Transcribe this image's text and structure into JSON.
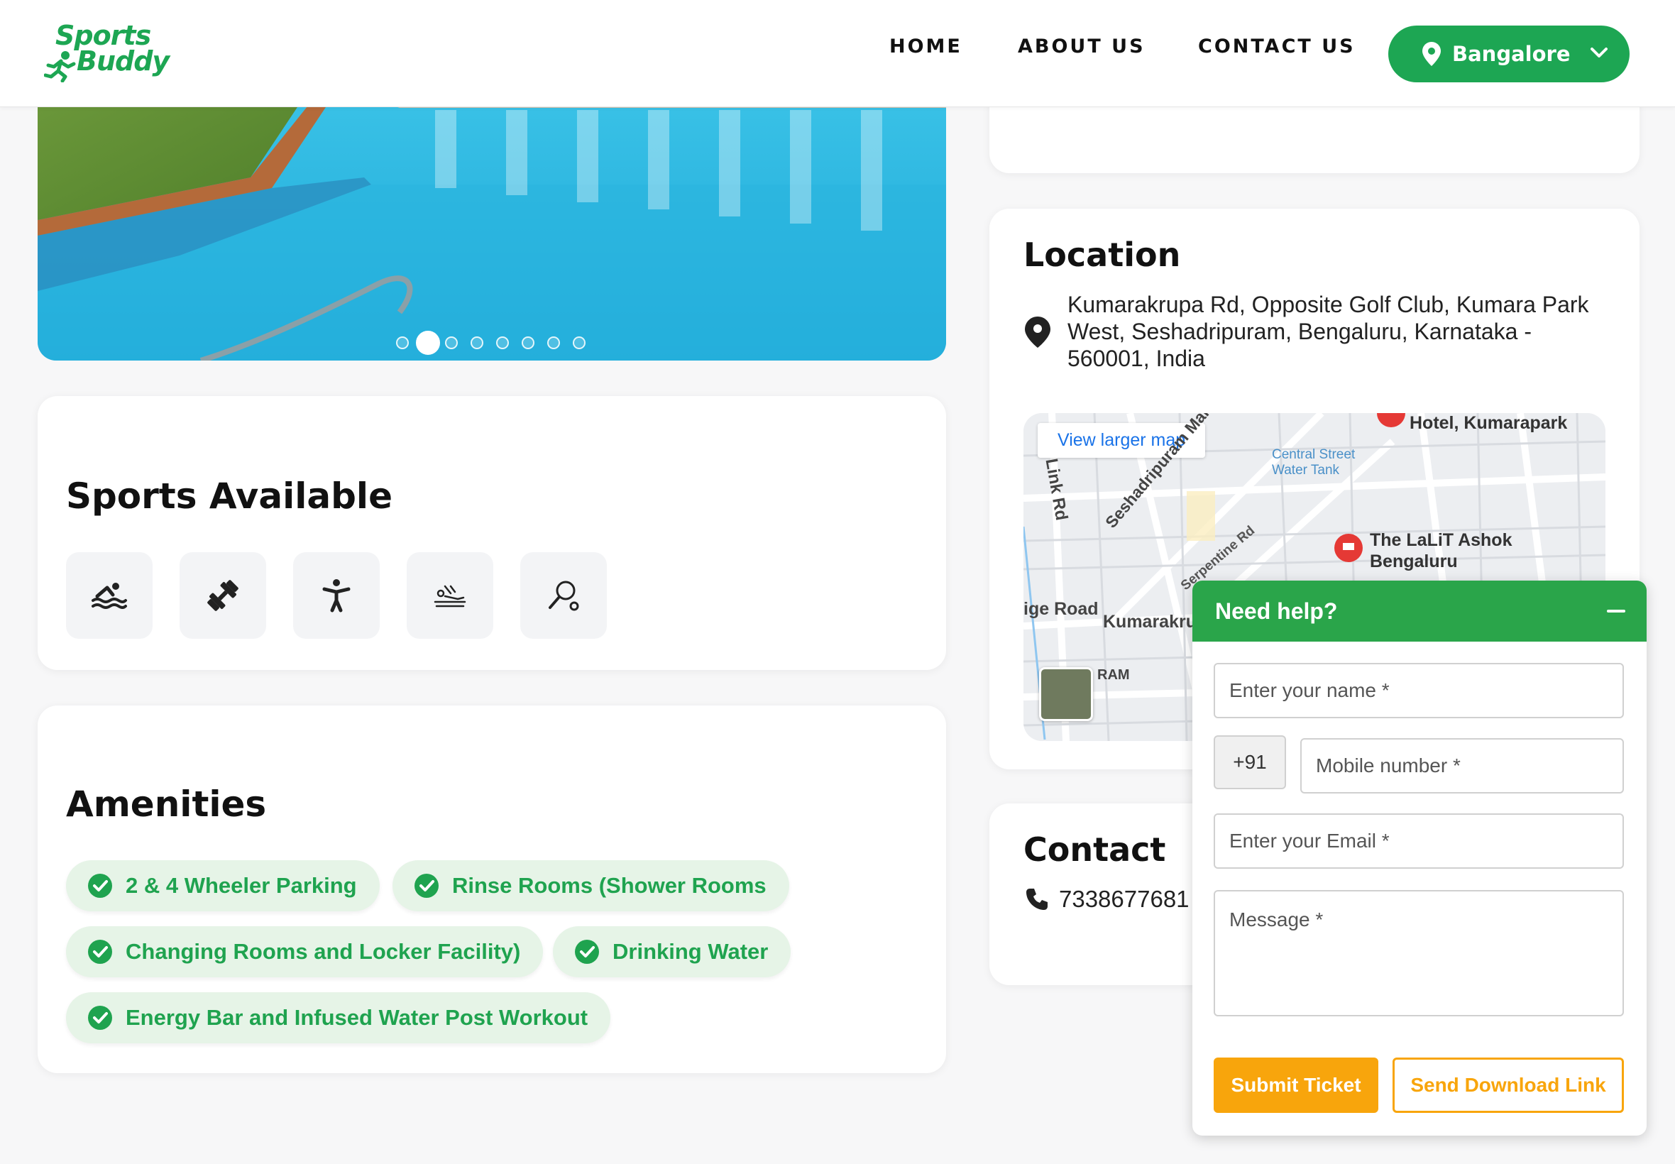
{
  "brand": {
    "line1": "Sports",
    "line2": "Buddy",
    "color": "#1da653"
  },
  "nav": {
    "home": "HOME",
    "about": "ABOUT US",
    "contact": "CONTACT US"
  },
  "city": {
    "selected": "Bangalore"
  },
  "gallery": {
    "slide_count": 8,
    "active_index": 1
  },
  "sports": {
    "title": "Sports Available",
    "icons": [
      "swimming-icon",
      "dumbbell-icon",
      "fitness-person-icon",
      "massage-icon",
      "racquet-icon"
    ]
  },
  "amenities": {
    "title": "Amenities",
    "items": [
      "2 & 4 Wheeler Parking",
      "Rinse Rooms (Shower Rooms",
      "Changing Rooms and Locker Facility)",
      "Drinking Water",
      "Energy Bar and Infused Water Post Workout"
    ]
  },
  "location": {
    "title": "Location",
    "address": "Kumarakrupa Rd, Opposite Golf Club, Kumara Park West, Seshadripuram, Bengaluru, Karnataka - 560001, India",
    "map": {
      "view_larger": "View larger map",
      "labels": {
        "hotel": "Hotel, Kumarapark",
        "tank": "Central Street Water Tank",
        "lalit": "The LaLiT Ashok Bengaluru",
        "link_rd": "Link Rd",
        "main_rd": "Seshadripuram Main Rd",
        "serpentine": "Serpentine Rd",
        "bridge": "ige Road",
        "kumara": "Kumarakru",
        "ram": "RAM"
      }
    }
  },
  "contact": {
    "title": "Contact",
    "phone": "7338677681"
  },
  "help": {
    "title": "Need help?",
    "name_placeholder": "Enter your name *",
    "country_code": "+91",
    "mobile_placeholder": "Mobile number *",
    "email_placeholder": "Enter your Email *",
    "message_placeholder": "Message *",
    "submit": "Submit Ticket",
    "download": "Send Download Link",
    "colors": {
      "header": "#2aa54a",
      "accent": "#f8a50c"
    }
  }
}
